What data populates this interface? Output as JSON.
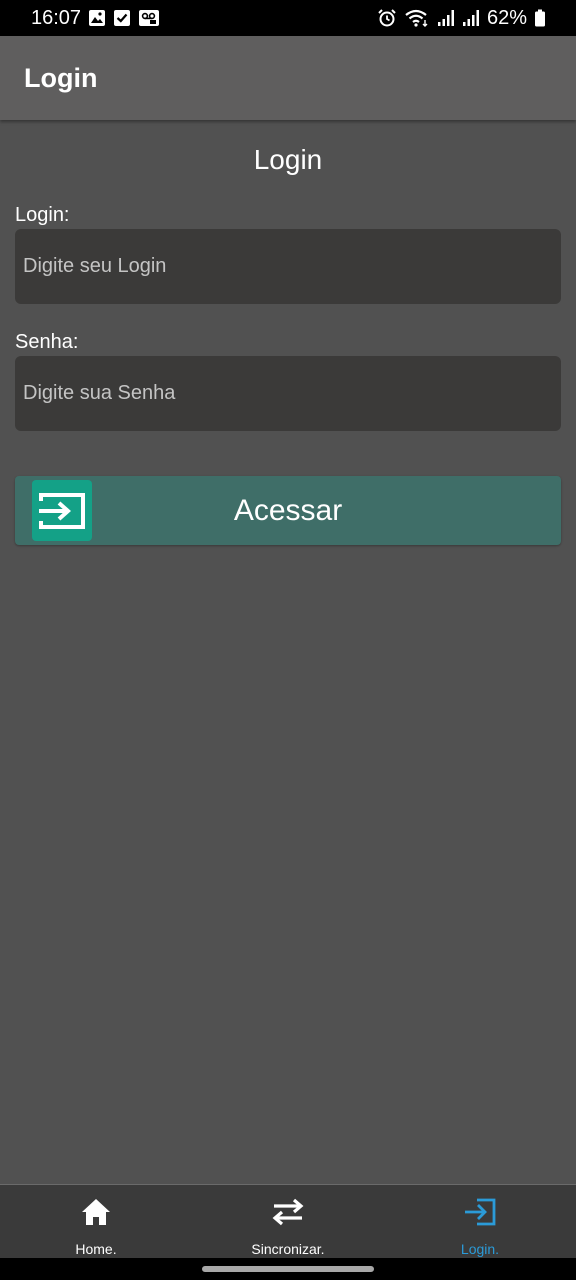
{
  "status_bar": {
    "time": "16:07",
    "battery": "62%",
    "icons": [
      "gallery-icon",
      "check-icon",
      "voicemail-icon",
      "alarm-icon",
      "wifi-icon",
      "signal-icon",
      "signal-icon",
      "battery-icon"
    ]
  },
  "app_bar": {
    "title": "Login"
  },
  "form": {
    "title": "Login",
    "login_label": "Login:",
    "login_placeholder": "Digite seu Login",
    "login_value": "",
    "password_label": "Senha:",
    "password_placeholder": "Digite sua Senha",
    "password_value": "",
    "access_button_label": "Acessar",
    "access_button_icon": "login-icon",
    "colors": {
      "background": "#515151",
      "input_background": "#3b3a39",
      "button_background": "#3f6e68",
      "button_icon_background": "#14a187"
    }
  },
  "bottom_nav": {
    "active_color": "#2b9bd8",
    "items": [
      {
        "label": "Home.",
        "icon": "home-icon",
        "active": false
      },
      {
        "label": "Sincronizar.",
        "icon": "sync-arrows-icon",
        "active": false
      },
      {
        "label": "Login.",
        "icon": "login-icon",
        "active": true
      }
    ]
  }
}
